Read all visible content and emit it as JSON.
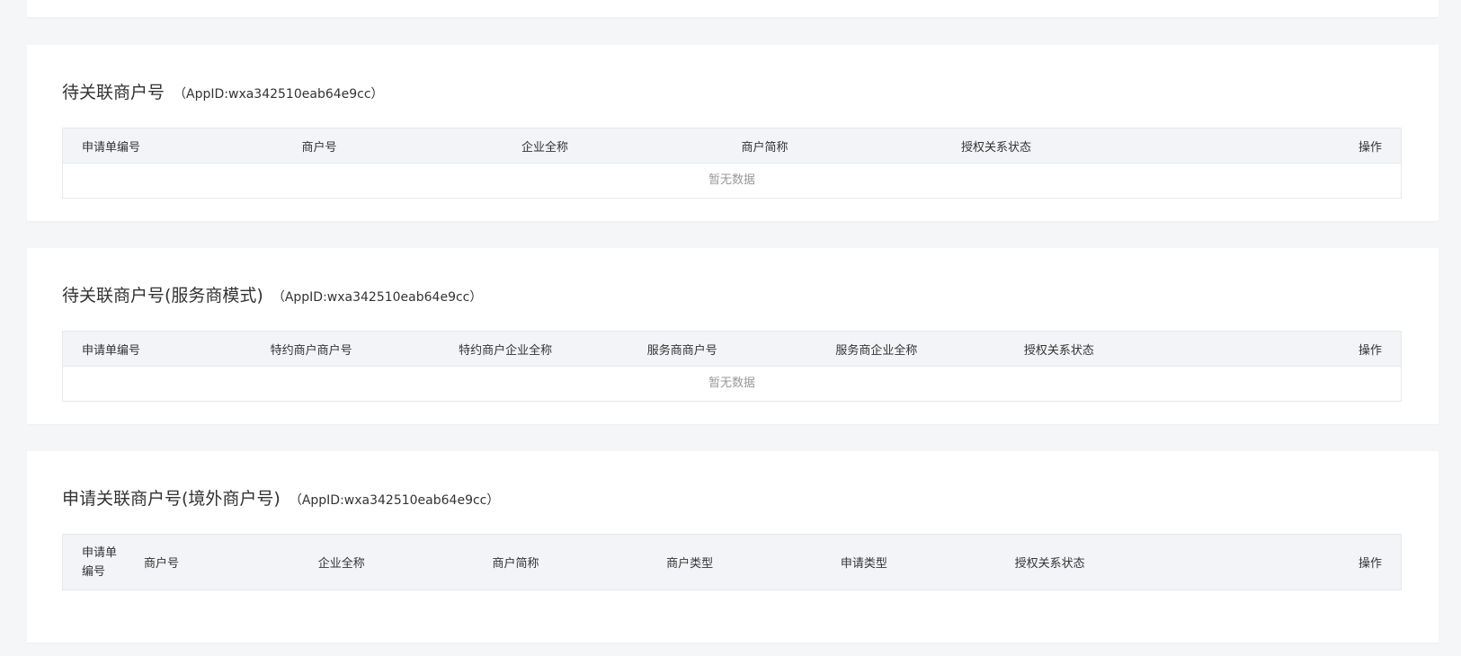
{
  "sections": [
    {
      "title": "待关联商户号",
      "appid": "（AppID:wxa342510eab64e9cc）",
      "columns": [
        "申请单编号",
        "商户号",
        "企业全称",
        "商户简称",
        "授权关系状态",
        "操作"
      ],
      "empty_text": "暂无数据"
    },
    {
      "title": "待关联商户号(服务商模式)",
      "appid": "（AppID:wxa342510eab64e9cc）",
      "columns": [
        "申请单编号",
        "特约商户商户号",
        "特约商户企业全称",
        "服务商商户号",
        "服务商企业全称",
        "授权关系状态",
        "操作"
      ],
      "empty_text": "暂无数据"
    },
    {
      "title": "申请关联商户号(境外商户号)",
      "appid": "（AppID:wxa342510eab64e9cc）",
      "columns": [
        "申请单编号",
        "商户号",
        "企业全称",
        "商户简称",
        "商户类型",
        "申请类型",
        "授权关系状态",
        "操作"
      ]
    }
  ]
}
